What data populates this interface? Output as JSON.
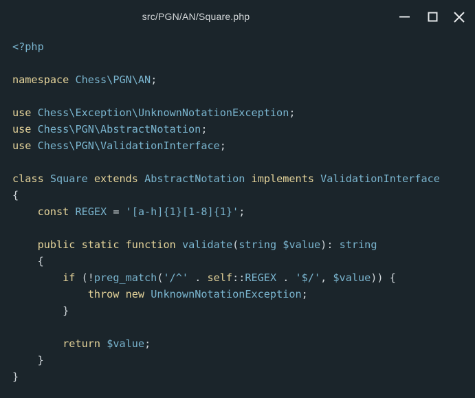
{
  "window": {
    "title": "src/PGN/AN/Square.php",
    "controls": [
      "minimize",
      "maximize",
      "close"
    ]
  },
  "colors": {
    "background": "#1b252b",
    "keyword": "#e4d39a",
    "identifier": "#7ab5cf",
    "text": "#d0d6da"
  },
  "icons": {
    "minimize": "minimize-icon",
    "maximize": "maximize-icon",
    "close": "close-icon"
  },
  "code": {
    "language": "php",
    "lines": [
      [
        [
          "tag",
          "<?php"
        ]
      ],
      [],
      [
        [
          "keyword",
          "namespace"
        ],
        [
          "plain",
          " "
        ],
        [
          "name",
          "Chess\\PGN\\AN"
        ],
        [
          "plain",
          ";"
        ]
      ],
      [],
      [
        [
          "keyword",
          "use"
        ],
        [
          "plain",
          " "
        ],
        [
          "name",
          "Chess\\Exception\\UnknownNotationException"
        ],
        [
          "plain",
          ";"
        ]
      ],
      [
        [
          "keyword",
          "use"
        ],
        [
          "plain",
          " "
        ],
        [
          "name",
          "Chess\\PGN\\AbstractNotation"
        ],
        [
          "plain",
          ";"
        ]
      ],
      [
        [
          "keyword",
          "use"
        ],
        [
          "plain",
          " "
        ],
        [
          "name",
          "Chess\\PGN\\ValidationInterface"
        ],
        [
          "plain",
          ";"
        ]
      ],
      [],
      [
        [
          "keyword",
          "class"
        ],
        [
          "plain",
          " "
        ],
        [
          "name",
          "Square"
        ],
        [
          "plain",
          " "
        ],
        [
          "keyword",
          "extends"
        ],
        [
          "plain",
          " "
        ],
        [
          "name",
          "AbstractNotation"
        ],
        [
          "plain",
          " "
        ],
        [
          "keyword",
          "implements"
        ],
        [
          "plain",
          " "
        ],
        [
          "name",
          "ValidationInterface"
        ]
      ],
      [
        [
          "plain",
          "{"
        ]
      ],
      [
        [
          "plain",
          "    "
        ],
        [
          "keyword",
          "const"
        ],
        [
          "plain",
          " "
        ],
        [
          "name",
          "REGEX"
        ],
        [
          "plain",
          " = "
        ],
        [
          "string",
          "'[a-h]{1}[1-8]{1}'"
        ],
        [
          "plain",
          ";"
        ]
      ],
      [],
      [
        [
          "plain",
          "    "
        ],
        [
          "keyword",
          "public"
        ],
        [
          "plain",
          " "
        ],
        [
          "keyword",
          "static"
        ],
        [
          "plain",
          " "
        ],
        [
          "keyword",
          "function"
        ],
        [
          "plain",
          " "
        ],
        [
          "name",
          "validate"
        ],
        [
          "plain",
          "("
        ],
        [
          "name",
          "string"
        ],
        [
          "plain",
          " "
        ],
        [
          "var",
          "$value"
        ],
        [
          "plain",
          "): "
        ],
        [
          "name",
          "string"
        ]
      ],
      [
        [
          "plain",
          "    {"
        ]
      ],
      [
        [
          "plain",
          "        "
        ],
        [
          "keyword",
          "if"
        ],
        [
          "plain",
          " (!"
        ],
        [
          "name",
          "preg_match"
        ],
        [
          "plain",
          "("
        ],
        [
          "string",
          "'/^'"
        ],
        [
          "plain",
          " . "
        ],
        [
          "keyword",
          "self"
        ],
        [
          "plain",
          "::"
        ],
        [
          "name",
          "REGEX"
        ],
        [
          "plain",
          " . "
        ],
        [
          "string",
          "'$/'"
        ],
        [
          "plain",
          ", "
        ],
        [
          "var",
          "$value"
        ],
        [
          "plain",
          ")) {"
        ]
      ],
      [
        [
          "plain",
          "            "
        ],
        [
          "keyword",
          "throw"
        ],
        [
          "plain",
          " "
        ],
        [
          "keyword",
          "new"
        ],
        [
          "plain",
          " "
        ],
        [
          "name",
          "UnknownNotationException"
        ],
        [
          "plain",
          ";"
        ]
      ],
      [
        [
          "plain",
          "        }"
        ]
      ],
      [],
      [
        [
          "plain",
          "        "
        ],
        [
          "keyword",
          "return"
        ],
        [
          "plain",
          " "
        ],
        [
          "var",
          "$value"
        ],
        [
          "plain",
          ";"
        ]
      ],
      [
        [
          "plain",
          "    }"
        ]
      ],
      [
        [
          "plain",
          "}"
        ]
      ]
    ]
  }
}
